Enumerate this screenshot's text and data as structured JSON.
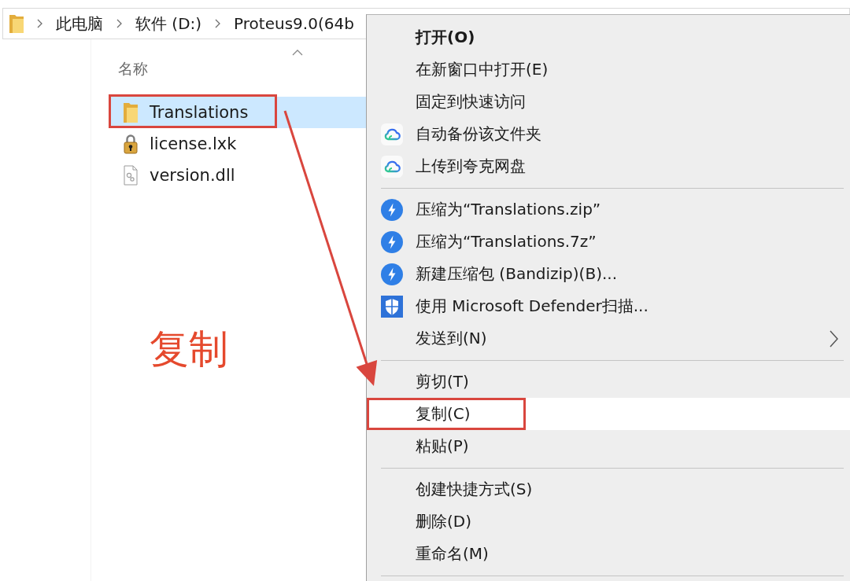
{
  "address_bar": {
    "path": [
      {
        "label": "此电脑"
      },
      {
        "label": "软件 (D:)"
      },
      {
        "label": "Proteus9.0(64b"
      }
    ]
  },
  "file_list": {
    "column_header": {
      "label": "名称",
      "sorted": true
    },
    "files": [
      {
        "name": "Translations",
        "kind": "folder",
        "selected": true,
        "annotated": true
      },
      {
        "name": "license.lxk",
        "kind": "license",
        "selected": false,
        "annotated": false
      },
      {
        "name": "version.dll",
        "kind": "dll",
        "selected": false,
        "annotated": false
      }
    ]
  },
  "annotation": {
    "label": "复制"
  },
  "context_menu": {
    "items": [
      {
        "kind": "plain",
        "label": "打开(O)",
        "default": true,
        "selected": false,
        "annotated": false,
        "submenu": false
      },
      {
        "kind": "plain",
        "label": "在新窗口中打开(E)",
        "default": false,
        "selected": false,
        "annotated": false,
        "submenu": false
      },
      {
        "kind": "plain",
        "label": "固定到快速访问",
        "default": false,
        "selected": false,
        "annotated": false,
        "submenu": false
      },
      {
        "kind": "cloud",
        "label": "自动备份该文件夹",
        "default": false,
        "selected": false,
        "annotated": false,
        "submenu": false
      },
      {
        "kind": "cloud",
        "label": "上传到夸克网盘",
        "default": false,
        "selected": false,
        "annotated": false,
        "submenu": false
      },
      {
        "kind": "separator"
      },
      {
        "kind": "archive",
        "label": "压缩为“Translations.zip”",
        "default": false,
        "selected": false,
        "annotated": false,
        "submenu": false
      },
      {
        "kind": "archive",
        "label": "压缩为“Translations.7z”",
        "default": false,
        "selected": false,
        "annotated": false,
        "submenu": false
      },
      {
        "kind": "archive",
        "label": "新建压缩包 (Bandizip)(B)...",
        "default": false,
        "selected": false,
        "annotated": false,
        "submenu": false
      },
      {
        "kind": "scan",
        "label": "使用 Microsoft Defender扫描...",
        "default": false,
        "selected": false,
        "annotated": false,
        "submenu": false
      },
      {
        "kind": "plain",
        "label": "发送到(N)",
        "default": false,
        "selected": false,
        "annotated": false,
        "submenu": true
      },
      {
        "kind": "separator"
      },
      {
        "kind": "plain",
        "label": "剪切(T)",
        "default": false,
        "selected": false,
        "annotated": false,
        "submenu": false
      },
      {
        "kind": "plain",
        "label": "复制(C)",
        "default": false,
        "selected": true,
        "annotated": true,
        "submenu": false
      },
      {
        "kind": "plain",
        "label": "粘贴(P)",
        "default": false,
        "selected": false,
        "annotated": false,
        "submenu": false
      },
      {
        "kind": "separator"
      },
      {
        "kind": "plain",
        "label": "创建快捷方式(S)",
        "default": false,
        "selected": false,
        "annotated": false,
        "submenu": false
      },
      {
        "kind": "plain",
        "label": "删除(D)",
        "default": false,
        "selected": false,
        "annotated": false,
        "submenu": false
      },
      {
        "kind": "plain",
        "label": "重命名(M)",
        "default": false,
        "selected": false,
        "annotated": false,
        "submenu": false
      },
      {
        "kind": "separator"
      }
    ]
  }
}
